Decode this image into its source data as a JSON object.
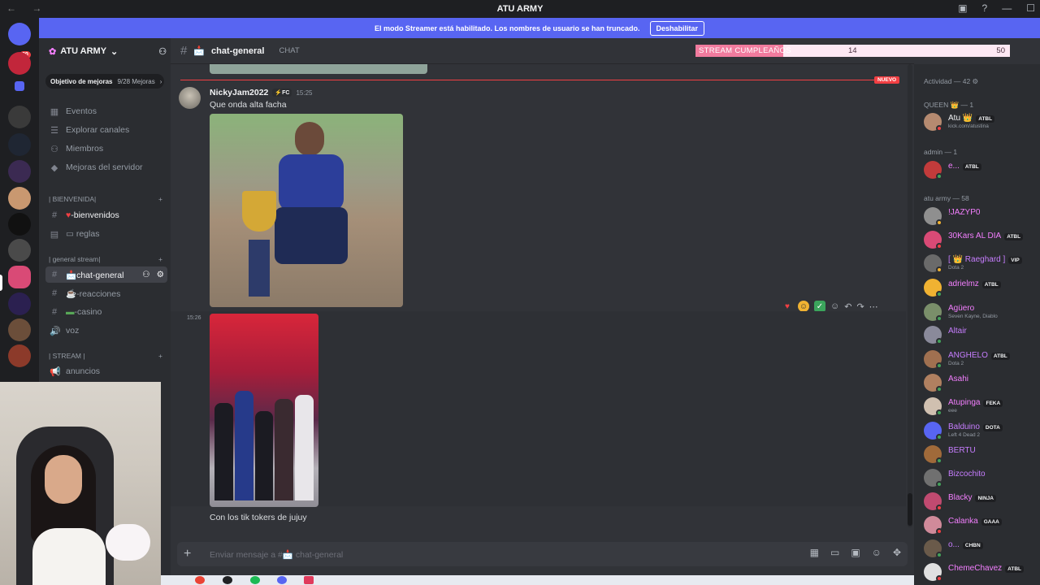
{
  "window": {
    "title": "ATU ARMY"
  },
  "banner": {
    "text": "El modo Streamer está habilitado. Los nombres de usuario se han truncado.",
    "button": "Deshabilitar"
  },
  "servers": {
    "badge": "80"
  },
  "sidebar": {
    "guild_name": "ATU ARMY",
    "boost": {
      "label": "Objetivo de mejoras",
      "count": "9/28 Mejoras"
    },
    "nav": [
      "Eventos",
      "Explorar canales",
      "Miembros",
      "Mejoras del servidor"
    ],
    "categories": {
      "bienvenida": "| BIENVENIDA|",
      "general": "| general stream|",
      "stream": "| STREAM |"
    },
    "channels": {
      "bienvenidos": "-bienvenidos",
      "reglas": "reglas",
      "chat_general": "chat-general",
      "reacciones": "-reacciones",
      "casino": "-casino",
      "voz": "voz",
      "anuncios": "anuncios"
    }
  },
  "chat": {
    "channel": "chat-general",
    "subtitle": "CHAT",
    "new_label": "NUEVO",
    "message": {
      "author": "NickyJam2022",
      "tag": "FC",
      "time": "15:25",
      "text": "Que onda alta facha"
    },
    "message2": {
      "time": "15:26",
      "caption": "Con los tik tokers de jujuy"
    },
    "composer_placeholder": "Enviar mensaje a #📩 chat-general"
  },
  "stream_goal": {
    "label": "STREAM CUMPLEAÑOS",
    "current": "14",
    "target": "50",
    "progress": 0.28
  },
  "members": {
    "activity": "Actividad — 42",
    "groups": {
      "queen": "QUEEN 👑 — 1",
      "admin": "admin — 1",
      "army": "atu army — 58"
    },
    "list": [
      {
        "name": "Atu 👑",
        "tag": "ATBL",
        "sub": "kick.com/atustina",
        "color": "#f2f3f5"
      },
      {
        "name": "e...",
        "tag": "ATBL",
        "sub": "",
        "color": "#f47fff"
      },
      {
        "name": "!JAZYP0",
        "tag": "",
        "sub": "",
        "color": "#f47fff"
      },
      {
        "name": "30Kars AL DIA",
        "tag": "ATBL",
        "sub": "",
        "color": "#f47fff"
      },
      {
        "name": "[ 👑 Raeghard ]",
        "tag": "VIP",
        "sub": "Dota 2",
        "color": "#c77dff"
      },
      {
        "name": "adrielmz",
        "tag": "ATBL",
        "sub": "",
        "color": "#f47fff"
      },
      {
        "name": "Agüero",
        "tag": "",
        "sub": "Seven Kayne, Diablo",
        "color": "#f47fff"
      },
      {
        "name": "Altair",
        "tag": "",
        "sub": "",
        "color": "#c77dff"
      },
      {
        "name": "ANGHELO",
        "tag": "ATBL",
        "sub": "Dota 2",
        "color": "#c77dff"
      },
      {
        "name": "Asahi",
        "tag": "",
        "sub": "",
        "color": "#f47fff"
      },
      {
        "name": "Atupinga",
        "tag": "FEKA",
        "sub": "eee",
        "color": "#f47fff"
      },
      {
        "name": "Balduino",
        "tag": "DOTA",
        "sub": "Left 4 Dead 2",
        "color": "#c77dff"
      },
      {
        "name": "BERTU",
        "tag": "",
        "sub": "",
        "color": "#c77dff"
      },
      {
        "name": "Bizcochito",
        "tag": "",
        "sub": "",
        "color": "#c77dff"
      },
      {
        "name": "Blacky",
        "tag": "NINJA",
        "sub": "",
        "color": "#f47fff"
      },
      {
        "name": "Calanka",
        "tag": "GAAA",
        "sub": "",
        "color": "#f47fff"
      },
      {
        "name": "o...",
        "tag": "CHBN",
        "sub": "",
        "color": "#c77dff"
      },
      {
        "name": "ChemeChavez",
        "tag": "ATBL",
        "sub": "",
        "color": "#f47fff"
      }
    ]
  }
}
